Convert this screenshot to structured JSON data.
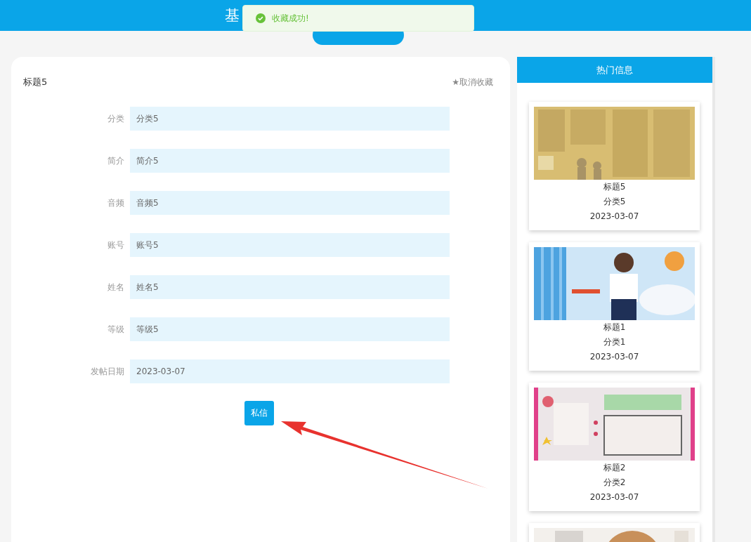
{
  "header": {
    "title": "基"
  },
  "toast": {
    "message": "收藏成功!"
  },
  "detail": {
    "title": "标题5",
    "favorite_action": "★取消收藏",
    "fields": [
      {
        "label": "分类",
        "value": "分类5"
      },
      {
        "label": "简介",
        "value": "简介5"
      },
      {
        "label": "音频",
        "value": "音频5"
      },
      {
        "label": "账号",
        "value": "账号5"
      },
      {
        "label": "姓名",
        "value": "姓名5"
      },
      {
        "label": "等级",
        "value": "等级5"
      },
      {
        "label": "发帖日期",
        "value": "2023-03-07"
      }
    ],
    "message_button": "私信"
  },
  "hot": {
    "title": "热门信息",
    "items": [
      {
        "kind": "card",
        "title": "标题5",
        "category": "分类5",
        "date": "2023-03-07"
      },
      {
        "kind": "card",
        "title": "标题1",
        "category": "分类1",
        "date": "2023-03-07"
      },
      {
        "kind": "card",
        "title": "标题2",
        "category": "分类2",
        "date": "2023-03-07"
      },
      {
        "kind": "cut"
      }
    ]
  }
}
